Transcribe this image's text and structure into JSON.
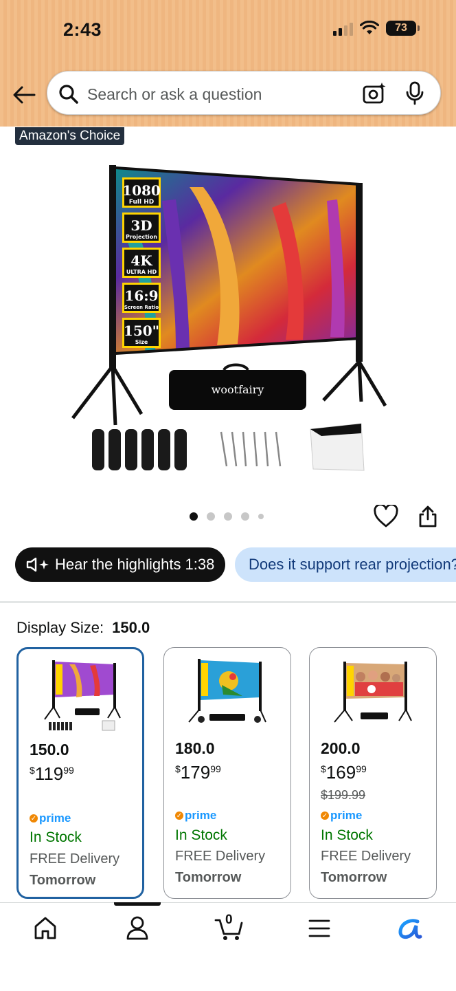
{
  "status_bar": {
    "time": "2:43",
    "battery": "73"
  },
  "search": {
    "placeholder": "Search or ask a question"
  },
  "product": {
    "badge": "Amazon's Choice",
    "image_brand": "wootfairy",
    "image_specs": [
      {
        "big": "1080",
        "small": "Full HD"
      },
      {
        "big": "3D",
        "small": "Projection"
      },
      {
        "big": "4K",
        "small": "ULTRA HD"
      },
      {
        "big": "16:9",
        "small": "Screen Ratio"
      },
      {
        "big": "150\"",
        "small": "Size"
      }
    ],
    "image_count": 5,
    "active_image": 1
  },
  "chips": {
    "hear_highlights": "Hear the highlights 1:38",
    "question": "Does it support rear projection?"
  },
  "display_size": {
    "label": "Display Size:",
    "value": "150.0"
  },
  "options": [
    {
      "size": "150.0",
      "price_symbol": "$",
      "price_whole": "119",
      "price_fraction": "99",
      "was": "",
      "prime": "prime",
      "stock": "In Stock",
      "delivery": "FREE Delivery",
      "when": "Tomorrow",
      "selected": true
    },
    {
      "size": "180.0",
      "price_symbol": "$",
      "price_whole": "179",
      "price_fraction": "99",
      "was": "",
      "prime": "prime",
      "stock": "In Stock",
      "delivery": "FREE Delivery",
      "when": "Tomorrow",
      "selected": false
    },
    {
      "size": "200.0",
      "price_symbol": "$",
      "price_whole": "169",
      "price_fraction": "99",
      "was": "$199.99",
      "prime": "prime",
      "stock": "In Stock",
      "delivery": "FREE Delivery",
      "when": "Tomorrow",
      "selected": false
    }
  ],
  "bottom_nav": {
    "cart_count": "0",
    "items": [
      "home-icon",
      "account-icon",
      "cart-icon",
      "menu-icon",
      "rufus-icon"
    ]
  },
  "colors": {
    "header": "#f2be8a",
    "selected_border": "#2162a1",
    "in_stock": "#007600",
    "prime": "#1a98ff"
  }
}
